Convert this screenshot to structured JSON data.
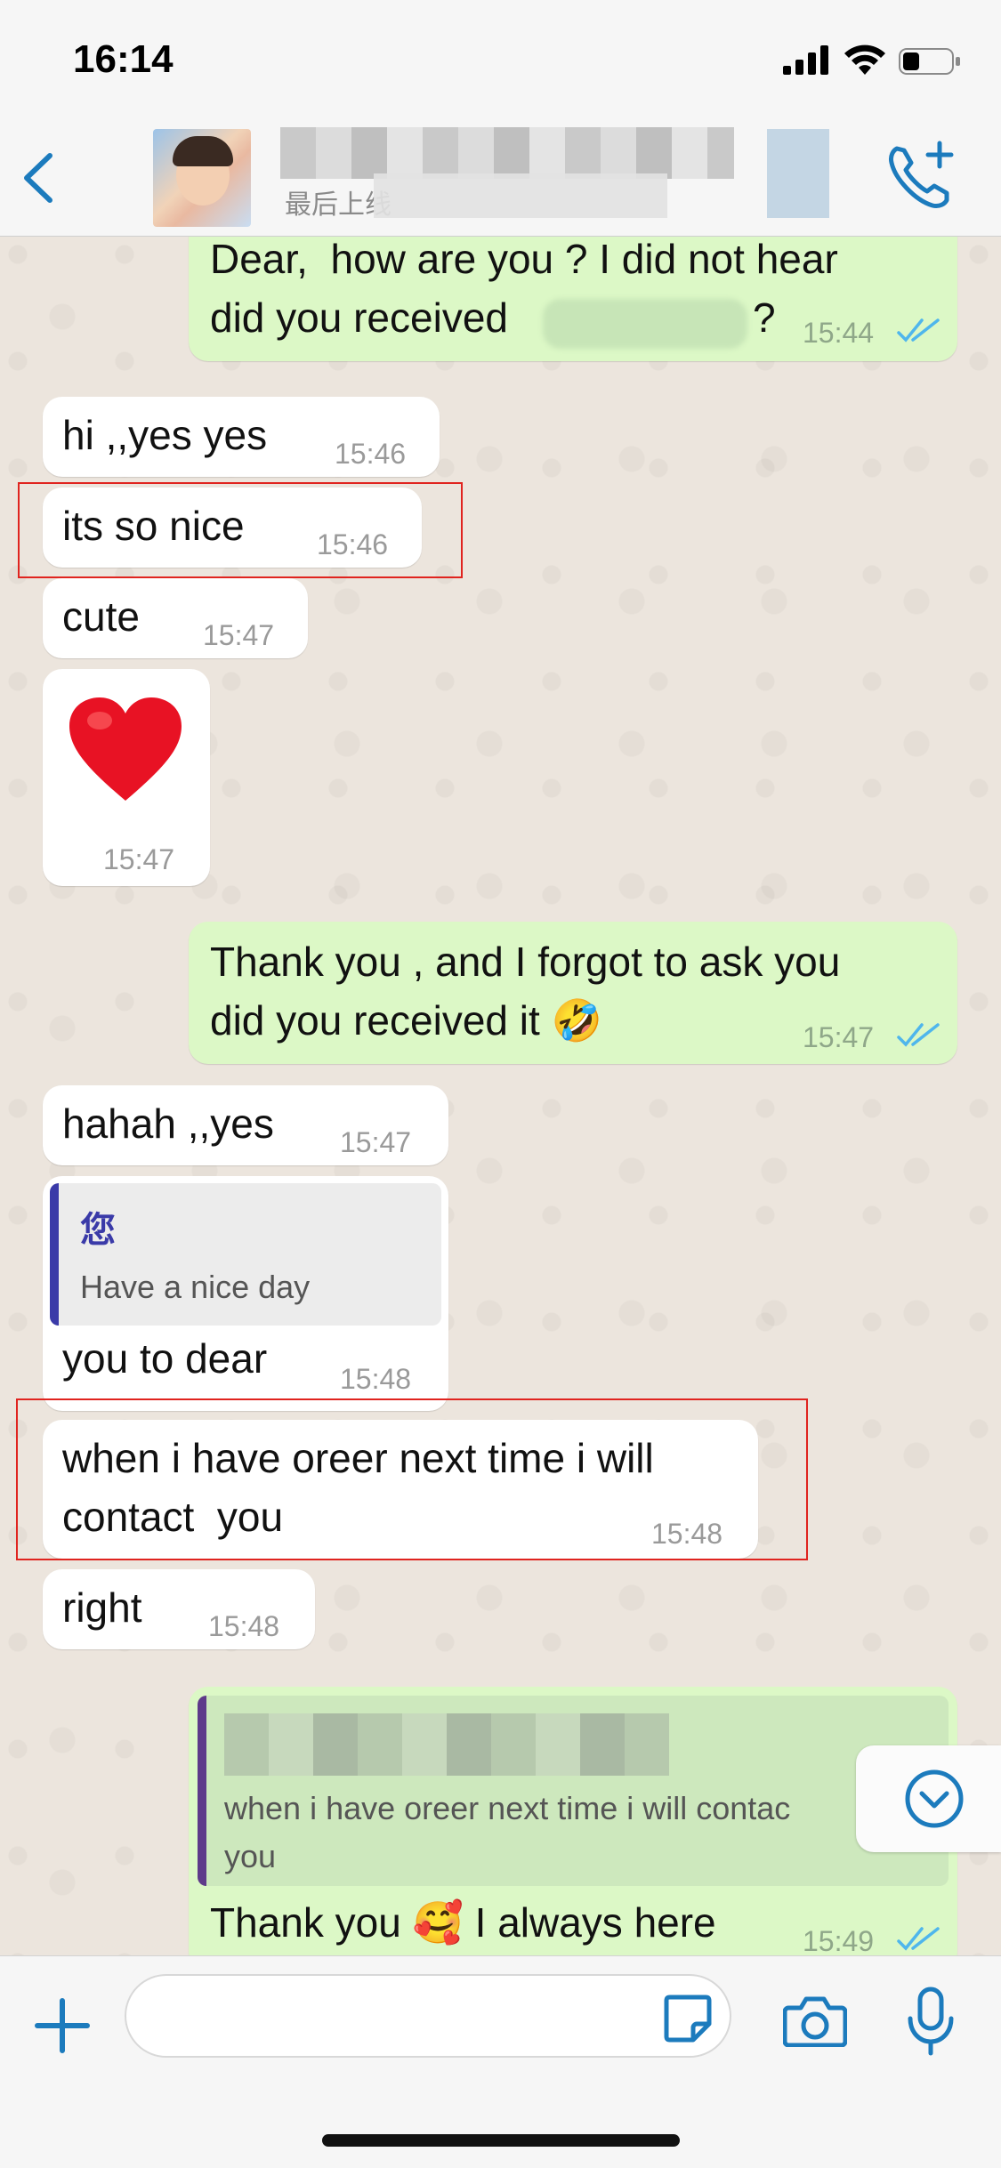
{
  "status_bar": {
    "time": "16:14"
  },
  "header": {
    "last_seen": "最后上线"
  },
  "messages": [
    {
      "id": "m1",
      "direction": "out",
      "text_line1": "Dear,  how are you ? I did not hear",
      "text_line2": "did you received",
      "text_suffix": "?",
      "time": "15:44"
    },
    {
      "id": "m2",
      "direction": "in",
      "text": "hi ,,yes yes",
      "time": "15:46"
    },
    {
      "id": "m3",
      "direction": "in",
      "text": "its so nice",
      "time": "15:46"
    },
    {
      "id": "m4",
      "direction": "in",
      "text": "cute",
      "time": "15:47"
    },
    {
      "id": "m5",
      "direction": "in",
      "text": "❤️",
      "time": "15:47"
    },
    {
      "id": "m6",
      "direction": "out",
      "text_line1": "Thank you , and I forgot to ask you",
      "text_line2": "did you received it 🤣",
      "time": "15:47"
    },
    {
      "id": "m7",
      "direction": "in",
      "text": "hahah ,,yes",
      "time": "15:47"
    },
    {
      "id": "m8",
      "direction": "in",
      "quote_author": "您",
      "quote_text": "Have a nice day",
      "text": "you to dear",
      "time": "15:48"
    },
    {
      "id": "m9",
      "direction": "in",
      "text_line1": "when i have oreer next time i will",
      "text_line2": "contact  you",
      "time": "15:48"
    },
    {
      "id": "m10",
      "direction": "in",
      "text": "right",
      "time": "15:48"
    },
    {
      "id": "m11",
      "direction": "out",
      "quote_text_line1": "when i have oreer next time i will contac",
      "quote_text_line2": "you",
      "text": "Thank you 🥰 I always here",
      "time": "15:49"
    }
  ],
  "colors": {
    "accent": "#1c7bbd",
    "outgoing_bubble": "#dcf8c6",
    "incoming_bubble": "#ffffff",
    "chat_background": "#ece5dd",
    "read_ticks": "#4fb6ec",
    "highlight_border": "#e0241f",
    "quote_bar_in": "#3a3aa8",
    "quote_bar_out": "#5e3a8a"
  },
  "icons": [
    "back-icon",
    "avatar",
    "call-add-icon",
    "double-check-icon",
    "scroll-down-icon",
    "plus-icon",
    "sticker-icon",
    "camera-icon",
    "microphone-icon"
  ]
}
